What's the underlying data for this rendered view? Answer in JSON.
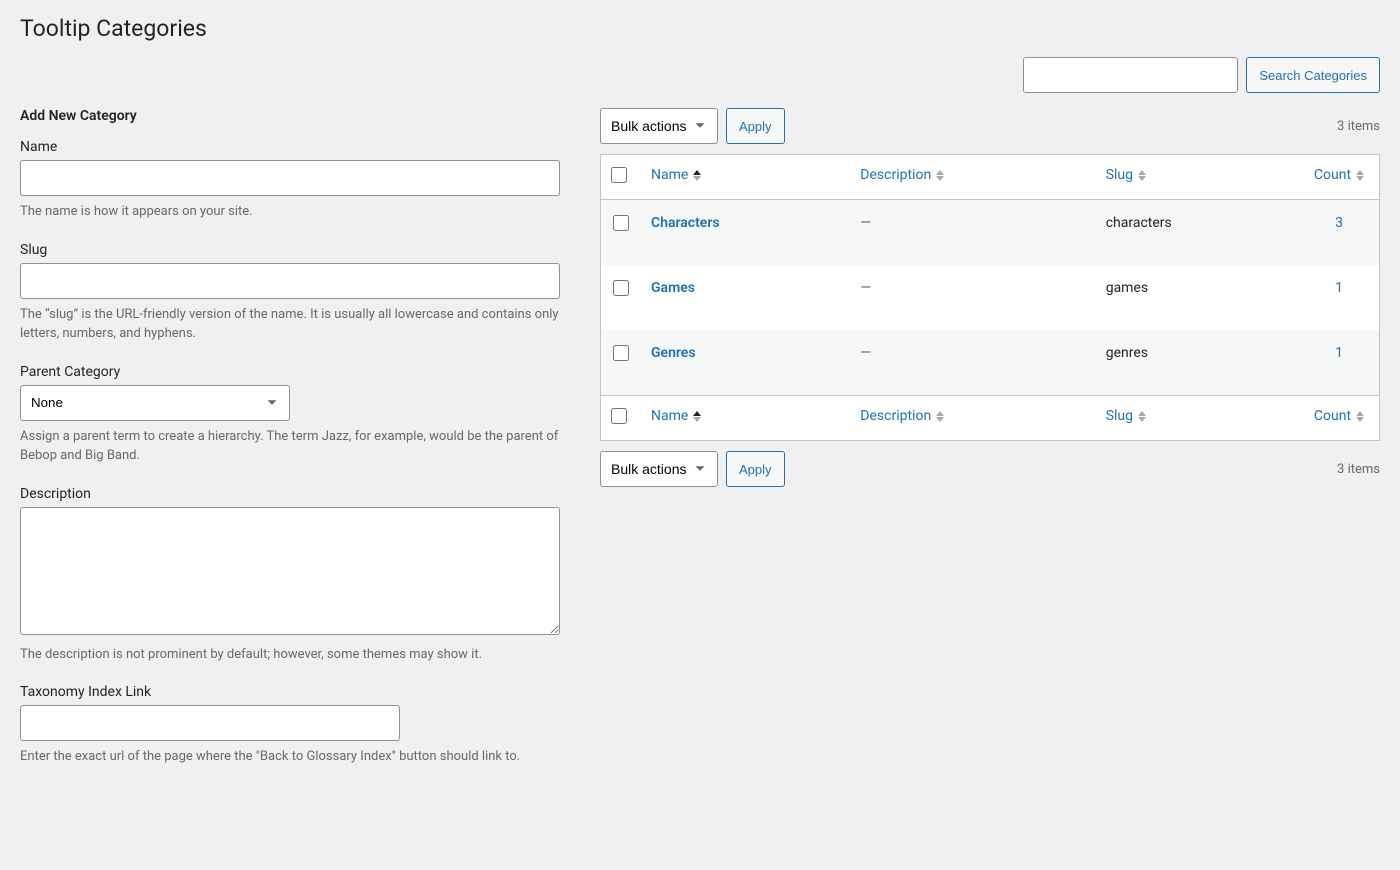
{
  "page_title": "Tooltip Categories",
  "search": {
    "button_label": "Search Categories"
  },
  "items_count": "3 items",
  "bulk_actions": {
    "selected_label": "Bulk actions",
    "apply_label": "Apply"
  },
  "form": {
    "heading": "Add New Category",
    "name": {
      "label": "Name",
      "help": "The name is how it appears on your site."
    },
    "slug": {
      "label": "Slug",
      "help": "The “slug” is the URL-friendly version of the name. It is usually all lowercase and contains only letters, numbers, and hyphens."
    },
    "parent": {
      "label": "Parent Category",
      "selected": "None",
      "help": "Assign a parent term to create a hierarchy. The term Jazz, for example, would be the parent of Bebop and Big Band."
    },
    "description": {
      "label": "Description",
      "help": "The description is not prominent by default; however, some themes may show it."
    },
    "taxonomy_link": {
      "label": "Taxonomy Index Link",
      "help": "Enter the exact url of the page where the \"Back to Glossary Index\" button should link to."
    }
  },
  "table": {
    "columns": {
      "name": "Name",
      "description": "Description",
      "slug": "Slug",
      "count": "Count"
    },
    "rows": [
      {
        "name": "Characters",
        "description": "—",
        "slug": "characters",
        "count": "3"
      },
      {
        "name": "Games",
        "description": "—",
        "slug": "games",
        "count": "1"
      },
      {
        "name": "Genres",
        "description": "—",
        "slug": "genres",
        "count": "1"
      }
    ]
  }
}
